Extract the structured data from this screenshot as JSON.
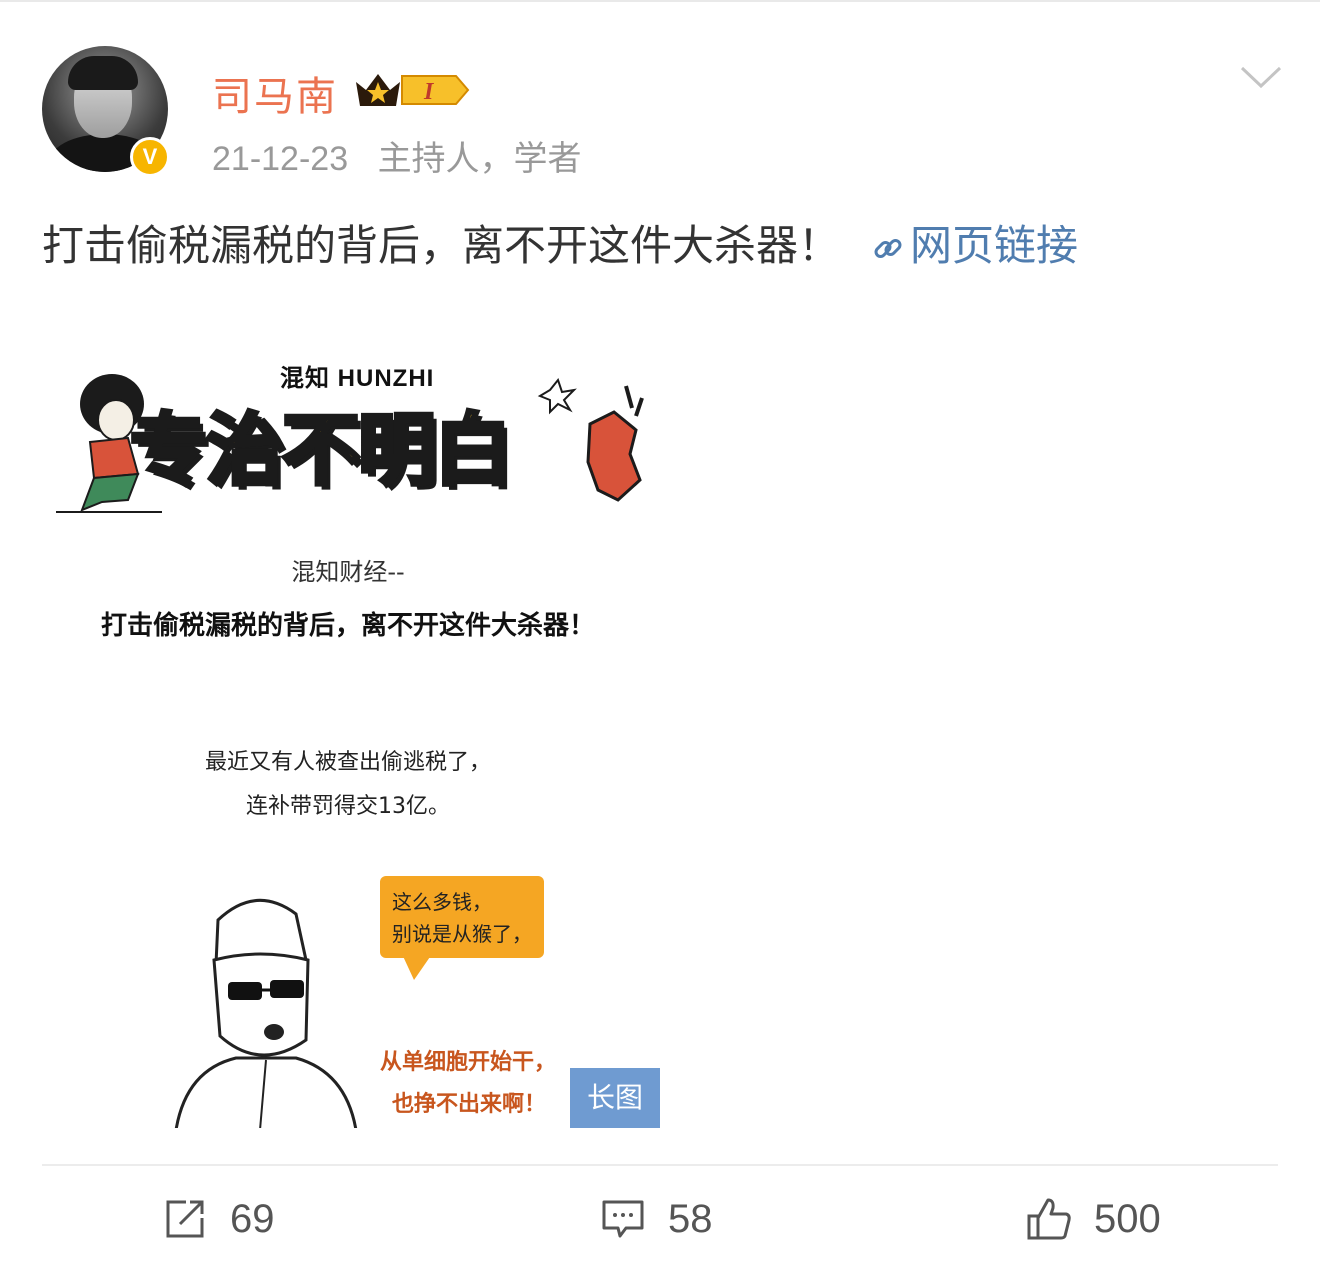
{
  "post": {
    "author": {
      "name": "司马南",
      "level_badge": "I",
      "verified_mark": "V"
    },
    "date": "21-12-23",
    "bio": "主持人，学者",
    "text": "打击偷税漏税的背后，离不开这件大杀器！",
    "link_label": "网页链接",
    "icons": {
      "more": "chevron-down-icon",
      "link": "link-icon",
      "repost": "repost-icon",
      "comment": "comment-icon",
      "like": "like-icon"
    },
    "image": {
      "brand": "混知 HUNZHI",
      "banner_title": "专治不明白",
      "subtitle": "混知财经--",
      "headline": "打击偷税漏税的背后，离不开这件大杀器！",
      "lines": [
        "最近又有人被查出偷逃税了，",
        "连补带罚得交13亿。"
      ],
      "bubble": [
        "这么多钱，",
        "别说是从猴了，"
      ],
      "exclaim": [
        "从单细胞开始干，",
        "也挣不出来啊！"
      ],
      "tag": "长图"
    },
    "stats": {
      "reposts": "69",
      "comments": "58",
      "likes": "500"
    }
  },
  "colors": {
    "username": "#eb7350",
    "link": "#507daf",
    "meta": "#999999",
    "verified": "#f7b500",
    "tag": "#6f9bd1"
  }
}
